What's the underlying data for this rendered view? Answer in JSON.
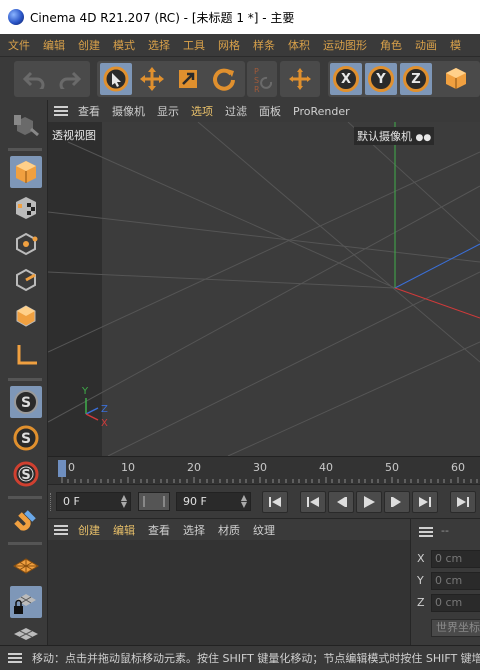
{
  "window": {
    "title": "Cinema 4D R21.207 (RC) - [未标题 1 *] - 主要"
  },
  "menubar": {
    "items": [
      "文件",
      "编辑",
      "创建",
      "模式",
      "选择",
      "工具",
      "网格",
      "样条",
      "体积",
      "运动图形",
      "角色",
      "动画",
      "模"
    ]
  },
  "toolbar": {
    "undo_icon": "undo-icon",
    "redo_icon": "redo-icon",
    "axis_x": "X",
    "axis_y": "Y",
    "axis_z": "Z",
    "accent_color": "#e0902e",
    "active_color": "#7e97b8"
  },
  "viewport": {
    "menu": [
      "查看",
      "摄像机",
      "显示",
      "选项",
      "过滤",
      "面板",
      "ProRender"
    ],
    "label": "透视视图",
    "camera_label": "默认摄像机",
    "axis_labels": {
      "x": "X",
      "y": "Y",
      "z": "Z"
    }
  },
  "timeline": {
    "ticks": [
      "0",
      "10",
      "20",
      "30",
      "40",
      "50",
      "60"
    ],
    "current_frame": "0"
  },
  "transport": {
    "start_field": "0 F",
    "end_field": "90 F"
  },
  "object_manager": {
    "menu": [
      "创建",
      "编辑",
      "查看",
      "选择",
      "材质",
      "纹理"
    ]
  },
  "coordinates": {
    "header": "--",
    "rows": [
      {
        "axis": "X",
        "value": "0 cm"
      },
      {
        "axis": "Y",
        "value": "0 cm"
      },
      {
        "axis": "Z",
        "value": "0 cm"
      }
    ],
    "world_button": "世界坐标"
  },
  "status": {
    "text": "移动：点击并拖动鼠标移动元素。按住 SHIFT 键量化移动；节点编辑模式时按住 SHIFT 键增加选择对象"
  }
}
